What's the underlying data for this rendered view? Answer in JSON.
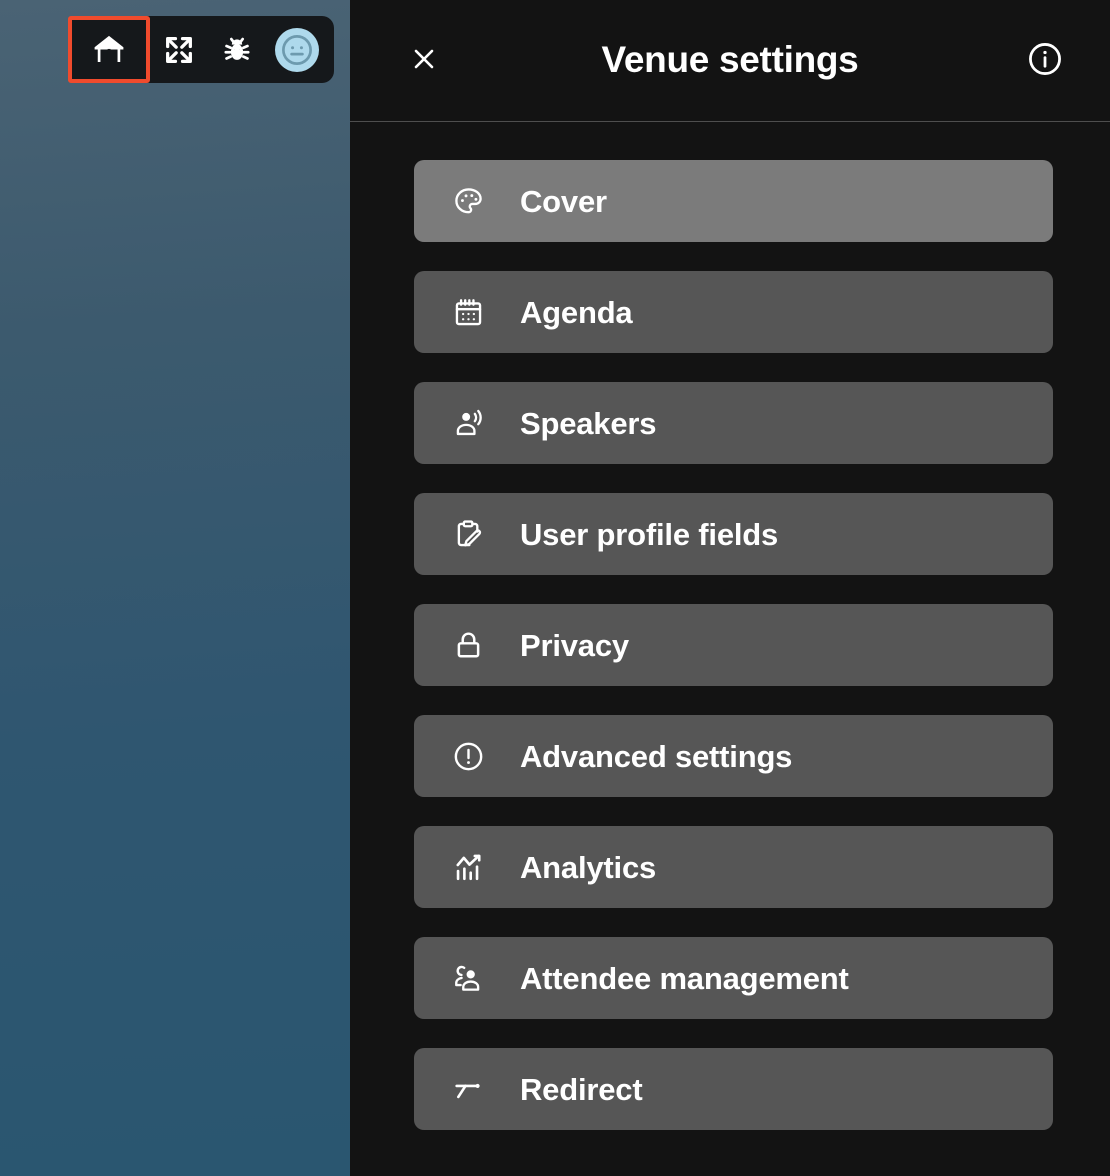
{
  "toolbar": {
    "buttons": [
      {
        "name": "venue-home",
        "icon": "venue-building-icon",
        "highlighted": true
      },
      {
        "name": "fullscreen",
        "icon": "fullscreen-expand-icon",
        "highlighted": false
      },
      {
        "name": "report-bug",
        "icon": "bug-icon",
        "highlighted": false
      },
      {
        "name": "user-avatar",
        "icon": "smiley-avatar-icon",
        "highlighted": false
      }
    ],
    "highlight_color": "#f04b2d",
    "background_color": "#15181b",
    "avatar_color": "#aed9ec"
  },
  "stage": {
    "gradient_top": "#4a6374",
    "gradient_bottom": "#2a5670"
  },
  "panel": {
    "background_color": "#131313",
    "header": {
      "title": "Venue settings",
      "close_label": "×",
      "close_icon": "close-x-icon",
      "info_icon": "info-circle-icon"
    },
    "item_background": "#565656",
    "item_active_background": "#7b7b7b",
    "menu_items": [
      {
        "label": "Cover",
        "icon": "palette-icon",
        "active": true
      },
      {
        "label": "Agenda",
        "icon": "calendar-icon",
        "active": false
      },
      {
        "label": "Speakers",
        "icon": "speaker-person-icon",
        "active": false
      },
      {
        "label": "User profile fields",
        "icon": "clipboard-pencil-icon",
        "active": false
      },
      {
        "label": "Privacy",
        "icon": "lock-icon",
        "active": false
      },
      {
        "label": "Advanced settings",
        "icon": "alert-circle-icon",
        "active": false
      },
      {
        "label": "Analytics",
        "icon": "analytics-chart-icon",
        "active": false
      },
      {
        "label": "Attendee management",
        "icon": "people-group-icon",
        "active": false
      },
      {
        "label": "Redirect",
        "icon": "redirect-branch-icon",
        "active": false
      }
    ]
  }
}
